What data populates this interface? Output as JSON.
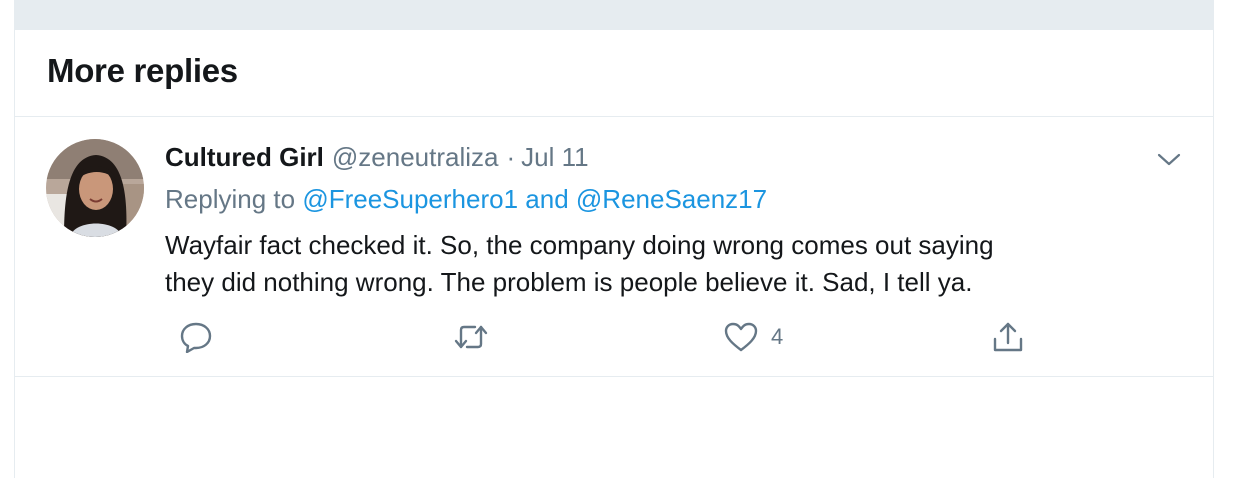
{
  "section": {
    "title": "More replies"
  },
  "tweet": {
    "display_name": "Cultured Girl",
    "handle": "@zeneutraliza",
    "separator": "·",
    "date": "Jul 11",
    "replying_prefix": "Replying to",
    "reply_mentions": [
      "@FreeSuperhero1",
      "@ReneSaenz17"
    ],
    "reply_conjunction": "and",
    "text_lines": [
      "Wayfair fact checked it.  So, the company doing wrong comes out saying",
      "they did nothing wrong.  The problem is people believe it. Sad, I tell ya."
    ],
    "actions": {
      "reply_icon": "reply-icon",
      "retweet_icon": "retweet-icon",
      "like_icon": "heart-icon",
      "like_count": "4",
      "share_icon": "share-icon"
    }
  },
  "colors": {
    "text_primary": "#14171a",
    "text_secondary": "#657786",
    "link": "#1b95e0",
    "border": "#e6ecf0"
  }
}
